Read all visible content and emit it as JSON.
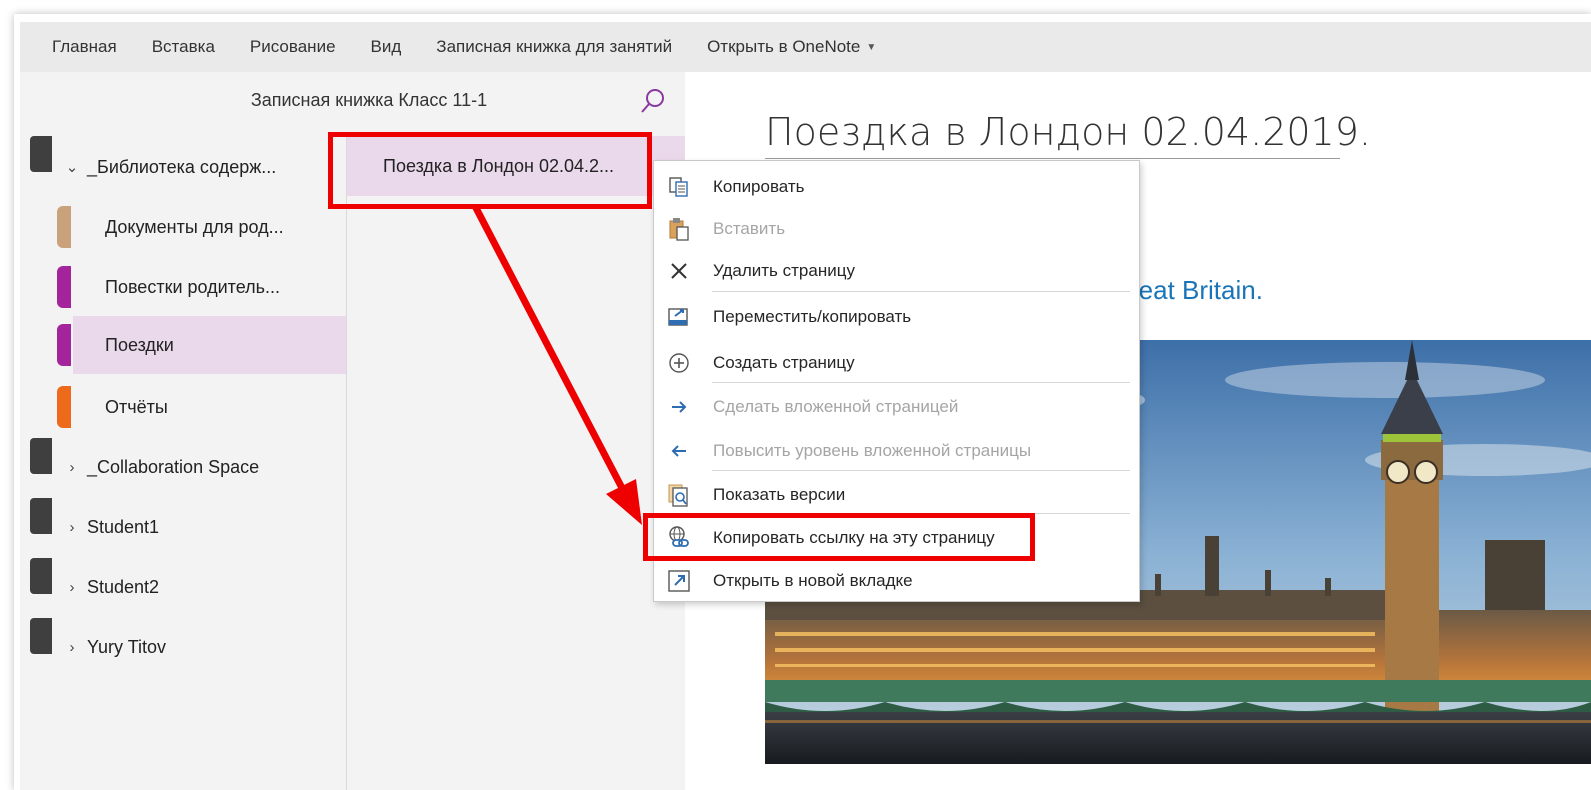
{
  "ribbon": {
    "tabs": [
      "Главная",
      "Вставка",
      "Рисование",
      "Вид",
      "Записная книжка для занятий",
      "Открыть в OneNote"
    ]
  },
  "notebook": {
    "title": "Записная книжка Класс 11-1"
  },
  "sections": {
    "group1": "_Библиотека содерж...",
    "items": [
      {
        "label": "Документы для род...",
        "color": "#c9a27b"
      },
      {
        "label": "Повестки родитель...",
        "color": "#a3249b"
      },
      {
        "label": "Поездки",
        "color": "#a3249b"
      },
      {
        "label": "Отчёты",
        "color": "#ec6a1a"
      }
    ],
    "groups": [
      "_Collaboration Space",
      "Student1",
      "Student2",
      "Yury Titov"
    ]
  },
  "pages": {
    "items": [
      {
        "label": "Поездка в Лондон 02.04.2..."
      }
    ]
  },
  "content": {
    "title": "Поездка в Лондон 02.04.2019.",
    "subtitle_visible": "reat Britain."
  },
  "context_menu": {
    "items": [
      {
        "label": "Копировать",
        "icon": "copy-icon",
        "disabled": false
      },
      {
        "label": "Вставить",
        "icon": "paste-icon",
        "disabled": true
      },
      {
        "label": "Удалить страницу",
        "icon": "delete-icon",
        "disabled": false
      },
      {
        "label": "Переместить/копировать",
        "icon": "move-copy-icon",
        "disabled": false
      },
      {
        "label": "Создать страницу",
        "icon": "add-page-icon",
        "disabled": false
      },
      {
        "label": "Сделать вложенной страницей",
        "icon": "arrow-right-icon",
        "disabled": true
      },
      {
        "label": "Повысить уровень вложенной страницы",
        "icon": "arrow-left-icon",
        "disabled": true
      },
      {
        "label": "Показать версии",
        "icon": "versions-icon",
        "disabled": false
      },
      {
        "label": "Копировать ссылку на эту страницу",
        "icon": "link-icon",
        "disabled": false
      },
      {
        "label": "Открыть в новой вкладке",
        "icon": "open-new-tab-icon",
        "disabled": false
      }
    ]
  },
  "colors": {
    "selection": "#ead9ea",
    "accent_purple": "#8a3a9e",
    "annotation_red": "#ee0000",
    "subtitle_blue": "#1a75b8"
  }
}
